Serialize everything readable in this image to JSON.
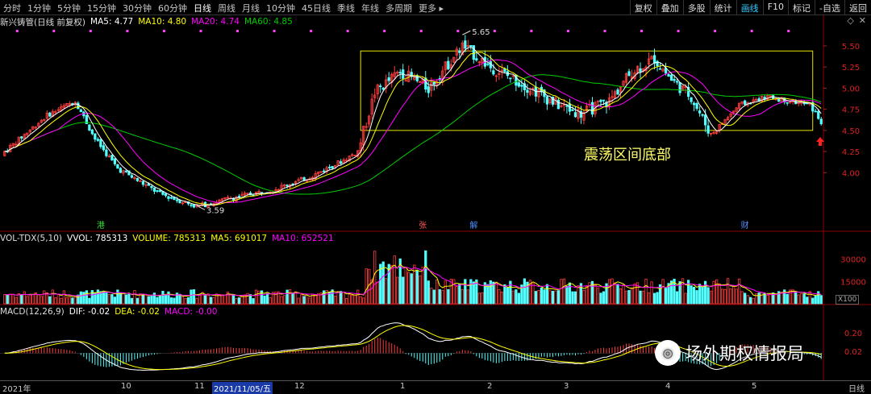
{
  "toolbar": {
    "tabs": [
      "分时",
      "1分钟",
      "5分钟",
      "15分钟",
      "30分钟",
      "60分钟",
      "日线",
      "周线",
      "月线",
      "10分钟",
      "45日线",
      "季线",
      "年线",
      "多周期",
      "更多 ▸"
    ],
    "active_tab": "日线",
    "right_buttons": [
      "复权",
      "叠加",
      "多股",
      "统计",
      "画线",
      "F10",
      "标记",
      "-自选",
      "返回"
    ],
    "active_right": "画线"
  },
  "main_header": {
    "name": "新兴铸管(日线 前复权)",
    "ma5": "MA5: 4.77",
    "ma10": "MA10: 4.80",
    "ma20": "MA20: 4.74",
    "ma60": "MA60: 4.85"
  },
  "vol_header": {
    "name": "VOL-TDX(5,10)",
    "vvol": "VVOL: 785313",
    "volume": "VOLUME: 785313",
    "ma5": "MA5: 691017",
    "ma10": "MA10: 652521"
  },
  "macd_header": {
    "name": "MACD(12,26,9)",
    "dif": "DIF: -0.02",
    "dea": "DEA: -0.02",
    "macd": "MACD: -0.00"
  },
  "colors": {
    "up": "#ff3c3c",
    "down": "#54ffff",
    "ma5": "#ffffff",
    "ma10": "#ffff00",
    "ma20": "#ff00ff",
    "ma60": "#00cc00",
    "box": "#e6e600",
    "annotation": "#ffff66"
  },
  "annotations": {
    "high_label": "5.65",
    "low_label": "3.59",
    "box_label": "震荡区间底部",
    "event_labels": [
      "港",
      "张",
      "解",
      "财"
    ]
  },
  "x_axis": {
    "labels": [
      "2021年",
      "10",
      "11",
      "2021/11/05/五",
      "12",
      "1",
      "2",
      "3",
      "4",
      "5"
    ],
    "selected_date": "2021/11/05/五",
    "period": "日线"
  },
  "vol_scale_label": "X100",
  "brand": {
    "text": "场外期权情报局",
    "icon": "wechat-icon"
  },
  "chart_data": {
    "type": "candlestick",
    "price_axis": {
      "ticks": [
        4.0,
        4.25,
        4.5,
        4.75,
        5.0,
        5.25,
        5.5
      ],
      "range": [
        3.45,
        5.7
      ]
    },
    "volume_axis": {
      "ticks": [
        15000,
        30000
      ],
      "range": [
        0,
        40000
      ],
      "unit": "X100"
    },
    "macd_axis": {
      "ticks": [
        0.2,
        0.02
      ],
      "range": [
        -0.25,
        0.35
      ]
    },
    "box": {
      "top": 5.44,
      "bottom": 4.5
    },
    "high": 5.65,
    "low": 3.59,
    "last": {
      "ma5": 4.77,
      "ma10": 4.8,
      "ma20": 4.74,
      "ma60": 4.85,
      "volume": 785313,
      "vol_ma5": 691017,
      "vol_ma10": 652521,
      "dif": -0.02,
      "dea": -0.02,
      "macd": -0.0
    }
  }
}
